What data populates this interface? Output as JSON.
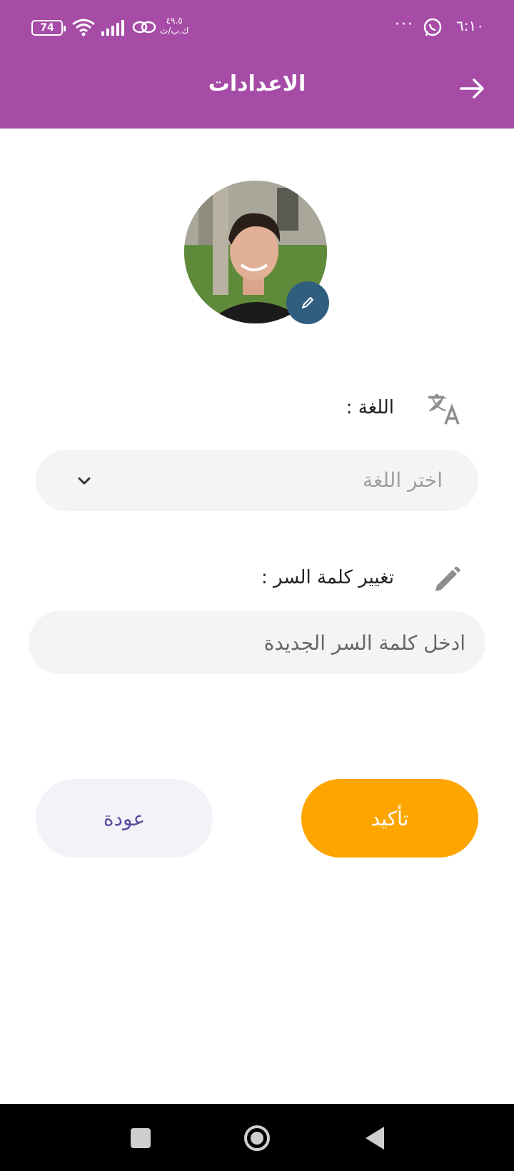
{
  "status_bar": {
    "time": "٦:١٠",
    "overflow": "···",
    "battery": "74",
    "speed": "٤٩.٥\nك.ب/ث",
    "icons": [
      "whatsapp-icon",
      "wifi-icon",
      "signal-icon",
      "link-icon",
      "battery-icon"
    ]
  },
  "header": {
    "title": "الاعدادات",
    "back_icon": "arrow-right-icon"
  },
  "profile": {
    "avatar_alt": "profile photo",
    "edit_icon": "pencil-icon"
  },
  "language": {
    "label": "اللغة :",
    "icon": "translate-icon",
    "select_placeholder": "اختر اللغة",
    "chevron_icon": "chevron-down-icon"
  },
  "password": {
    "label": "تغيير كلمة السر :",
    "icon": "pencil-icon",
    "placeholder": "ادخل كلمة السر الجديدة"
  },
  "actions": {
    "confirm_label": "تأكيد",
    "back_label": "عودة"
  },
  "colors": {
    "header_bg": "#a64ca6",
    "confirm_bg": "#ffa500",
    "back_bg": "#f3f2f8",
    "back_text": "#5b4a9e",
    "edit_avatar_bg": "#2f5e7e"
  },
  "navigation_bar": {
    "icons": [
      "recents-square-icon",
      "home-circle-icon",
      "back-triangle-icon"
    ]
  }
}
